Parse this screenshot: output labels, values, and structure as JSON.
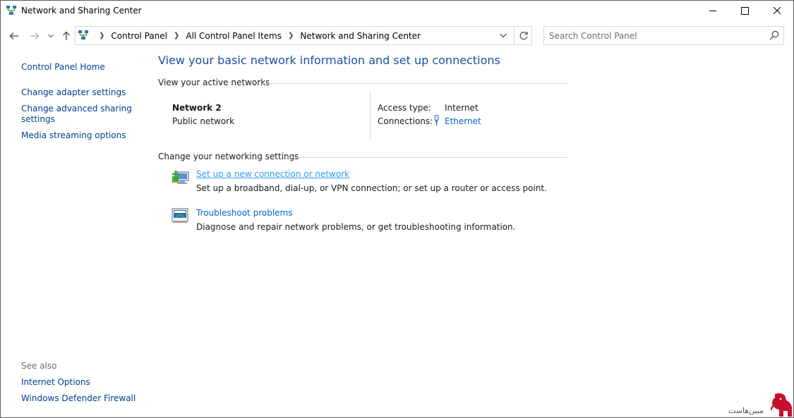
{
  "window": {
    "title": "Network and Sharing Center"
  },
  "navigation": {
    "breadcrumbs": [
      "Control Panel",
      "All Control Panel Items",
      "Network and Sharing Center"
    ],
    "search_placeholder": "Search Control Panel"
  },
  "sidebar": {
    "home": "Control Panel Home",
    "links": [
      "Change adapter settings",
      "Change advanced sharing",
      "settings",
      "Media streaming options"
    ],
    "see_also_label": "See also",
    "see_also": [
      "Internet Options",
      "Windows Defender Firewall"
    ]
  },
  "main": {
    "heading": "View your basic network information and set up connections",
    "active_networks_title": "View your active networks",
    "network": {
      "name": "Network 2",
      "category": "Public network",
      "access_type_label": "Access type:",
      "access_type_value": "Internet",
      "connections_label": "Connections:",
      "connections_value": "Ethernet"
    },
    "settings_title": "Change your networking settings",
    "tasks": [
      {
        "link": "Set up a new connection or network",
        "desc": "Set up a broadband, dial-up, or VPN connection; or set up a router or access point.",
        "icon": "new-connection-icon"
      },
      {
        "link": "Troubleshoot problems",
        "desc": "Diagnose and repair network problems, or get troubleshooting information.",
        "icon": "troubleshoot-icon"
      }
    ]
  },
  "watermark": {
    "text": "مبین‌هاست"
  },
  "colors": {
    "heading": "#1e4e9c",
    "link": "#0066cc",
    "sidebar_link": "#003e92",
    "watermark": "#c8102e"
  }
}
